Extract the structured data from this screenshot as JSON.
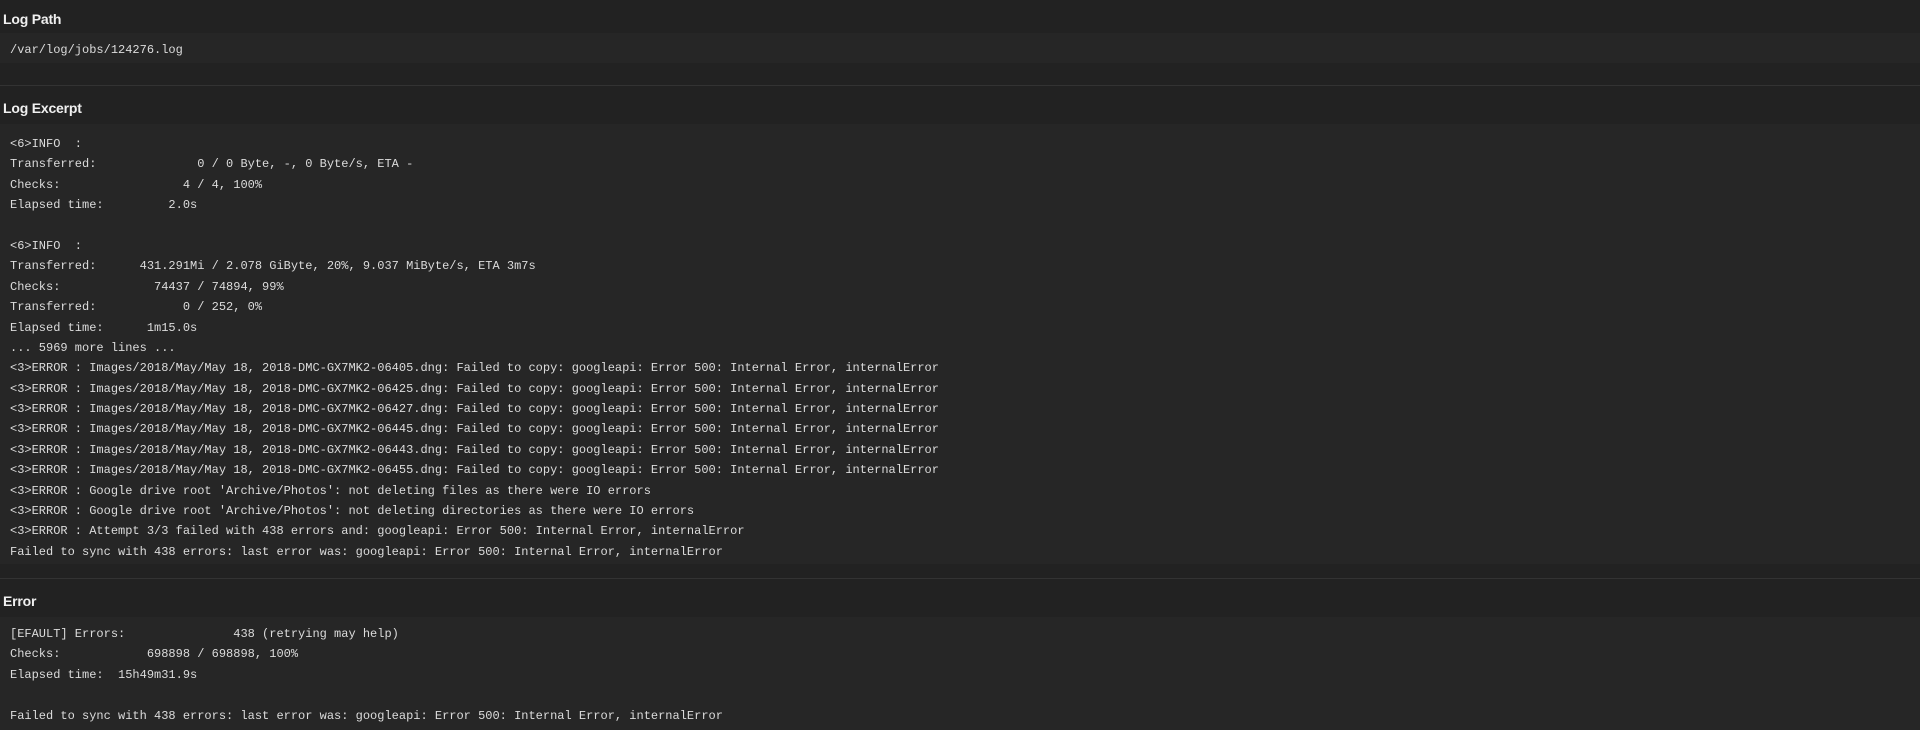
{
  "log_path": {
    "title": "Log Path",
    "value": "/var/log/jobs/124276.log"
  },
  "log_excerpt": {
    "title": "Log Excerpt",
    "lines": [
      "<6>INFO  :",
      "Transferred:              0 / 0 Byte, -, 0 Byte/s, ETA -",
      "Checks:                 4 / 4, 100%",
      "Elapsed time:         2.0s",
      "",
      "<6>INFO  :",
      "Transferred:      431.291Mi / 2.078 GiByte, 20%, 9.037 MiByte/s, ETA 3m7s",
      "Checks:             74437 / 74894, 99%",
      "Transferred:            0 / 252, 0%",
      "Elapsed time:      1m15.0s",
      "... 5969 more lines ...",
      "<3>ERROR : Images/2018/May/May 18, 2018-DMC-GX7MK2-06405.dng: Failed to copy: googleapi: Error 500: Internal Error, internalError",
      "<3>ERROR : Images/2018/May/May 18, 2018-DMC-GX7MK2-06425.dng: Failed to copy: googleapi: Error 500: Internal Error, internalError",
      "<3>ERROR : Images/2018/May/May 18, 2018-DMC-GX7MK2-06427.dng: Failed to copy: googleapi: Error 500: Internal Error, internalError",
      "<3>ERROR : Images/2018/May/May 18, 2018-DMC-GX7MK2-06445.dng: Failed to copy: googleapi: Error 500: Internal Error, internalError",
      "<3>ERROR : Images/2018/May/May 18, 2018-DMC-GX7MK2-06443.dng: Failed to copy: googleapi: Error 500: Internal Error, internalError",
      "<3>ERROR : Images/2018/May/May 18, 2018-DMC-GX7MK2-06455.dng: Failed to copy: googleapi: Error 500: Internal Error, internalError",
      "<3>ERROR : Google drive root 'Archive/Photos': not deleting files as there were IO errors",
      "<3>ERROR : Google drive root 'Archive/Photos': not deleting directories as there were IO errors",
      "<3>ERROR : Attempt 3/3 failed with 438 errors and: googleapi: Error 500: Internal Error, internalError",
      "Failed to sync with 438 errors: last error was: googleapi: Error 500: Internal Error, internalError"
    ]
  },
  "error": {
    "title": "Error",
    "lines": [
      "[EFAULT] Errors:               438 (retrying may help)",
      "Checks:            698898 / 698898, 100%",
      "Elapsed time:  15h49m31.9s",
      "",
      "Failed to sync with 438 errors: last error was: googleapi: Error 500: Internal Error, internalError"
    ]
  }
}
